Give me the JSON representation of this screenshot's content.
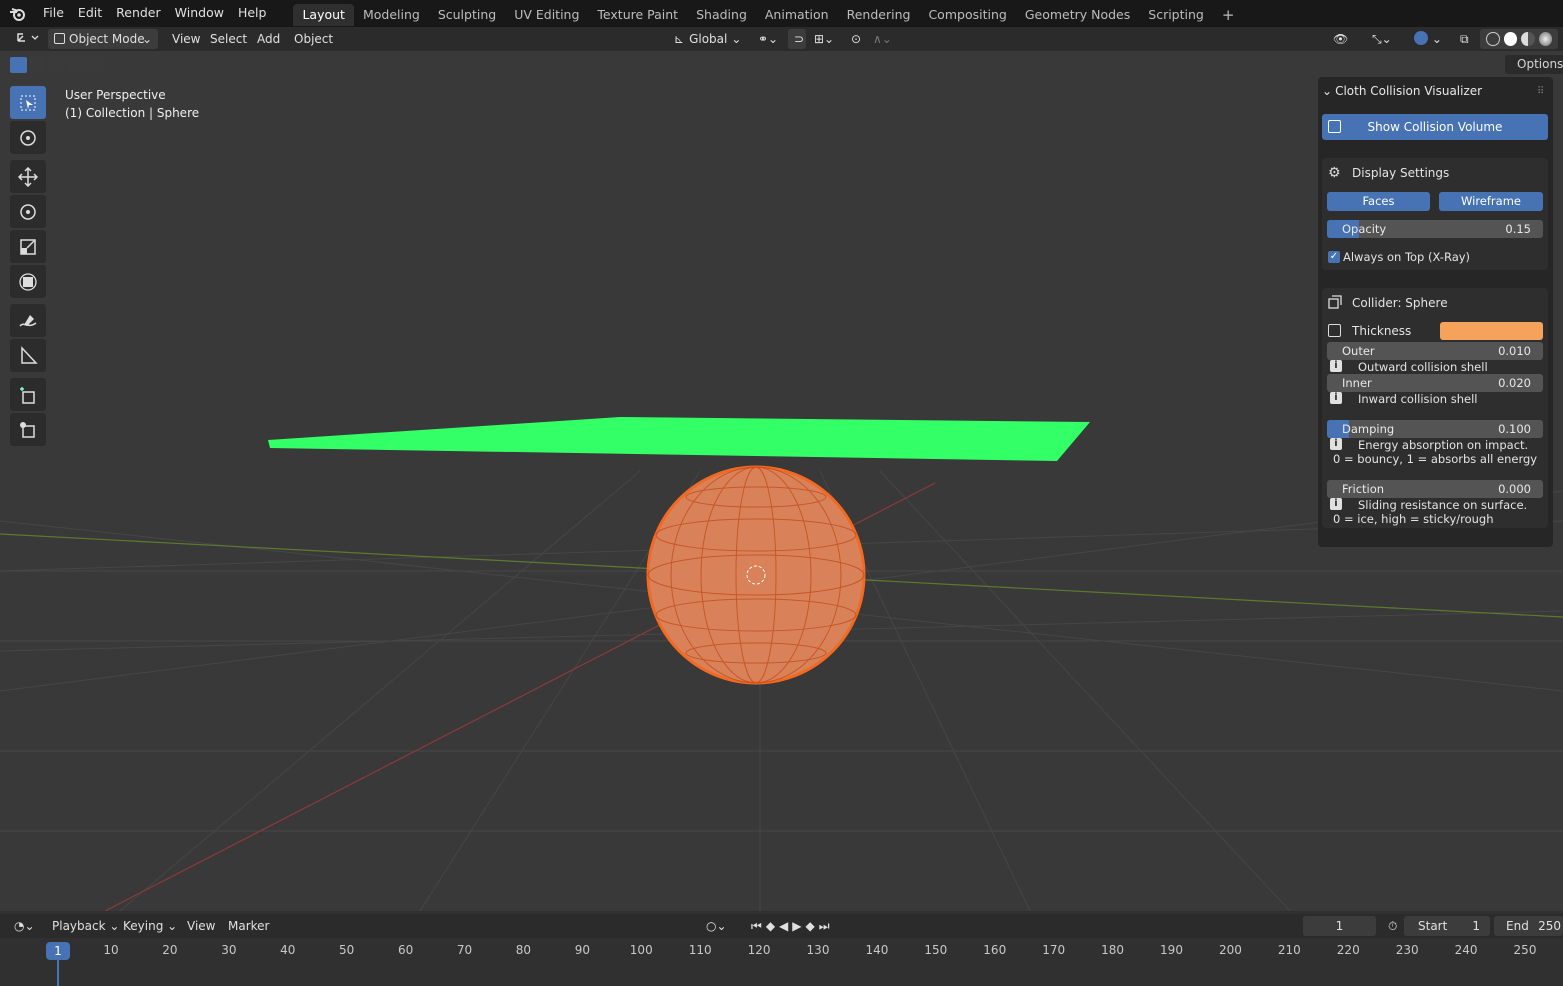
{
  "topbar": {
    "menus": [
      "File",
      "Edit",
      "Render",
      "Window",
      "Help"
    ],
    "workspaces": [
      "Layout",
      "Modeling",
      "Sculpting",
      "UV Editing",
      "Texture Paint",
      "Shading",
      "Animation",
      "Rendering",
      "Compositing",
      "Geometry Nodes",
      "Scripting"
    ],
    "active_workspace": "Layout",
    "add_tab": "+"
  },
  "header": {
    "mode": "Object Mode",
    "menus": [
      "View",
      "Select",
      "Add",
      "Object"
    ],
    "orientation": "Global",
    "options": "Options"
  },
  "viewport": {
    "overlay_title": "User Perspective",
    "overlay_subtitle": "(1) Collection | Sphere"
  },
  "panel": {
    "title": "Cloth Collision Visualizer",
    "show_button": "Show Collision Volume",
    "display": {
      "title": "Display Settings",
      "faces": "Faces",
      "wireframe": "Wireframe",
      "opacity_label": "Opacity",
      "opacity_value": "0.15",
      "opacity_fraction": 0.15,
      "xray_label": "Always on Top (X-Ray)",
      "xray_checked": true
    },
    "collider": {
      "title": "Collider: Sphere",
      "thickness_label": "Thickness",
      "thickness_color": "#f5a25a",
      "outer_label": "Outer",
      "outer_value": "0.010",
      "outer_desc": "Outward collision shell",
      "inner_label": "Inner",
      "inner_value": "0.020",
      "inner_desc": "Inward collision shell",
      "damping_label": "Damping",
      "damping_value": "0.100",
      "damping_fraction": 0.1,
      "damping_desc1": "Energy absorption on impact.",
      "damping_desc2": "0 = bouncy, 1 = absorbs all energy",
      "friction_label": "Friction",
      "friction_value": "0.000",
      "friction_desc1": "Sliding resistance on surface.",
      "friction_desc2": "0 = ice, high = sticky/rough"
    }
  },
  "timeline": {
    "menus": [
      "Playback",
      "Keying",
      "View",
      "Marker"
    ],
    "current_frame": "1",
    "start_label": "Start",
    "start_value": "1",
    "end_label": "End",
    "end_value": "250",
    "ticks": [
      "1",
      "10",
      "20",
      "30",
      "40",
      "50",
      "60",
      "70",
      "80",
      "90",
      "100",
      "110",
      "120",
      "130",
      "140",
      "150",
      "160",
      "170",
      "180",
      "190",
      "200",
      "210",
      "220",
      "230",
      "240",
      "250"
    ]
  },
  "colors": {
    "accent": "#4772b3",
    "plane": "#33ff66",
    "sphere": "#e8753c"
  }
}
